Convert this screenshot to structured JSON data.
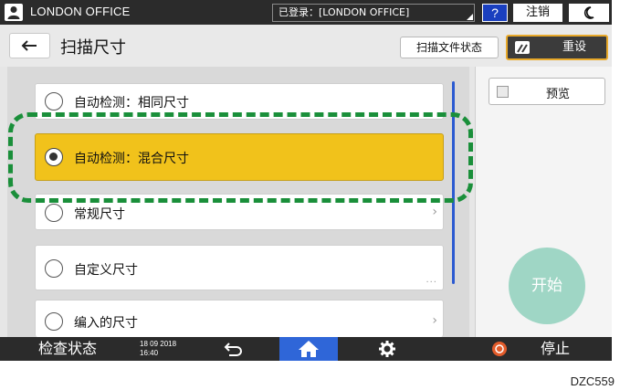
{
  "topbar": {
    "office_name": "LONDON OFFICE",
    "login_status": "已登录：[LONDON OFFICE]",
    "help_label": "?",
    "logout_label": "注销",
    "sleep_icon": "moon-icon"
  },
  "header": {
    "back_icon": "arrow-left-icon",
    "title": "扫描尺寸",
    "scan_status_label": "扫描文件状态",
    "reset_label": "重设",
    "reset_icon": "reset-icon"
  },
  "options": [
    {
      "label": "自动检测：相同尺寸",
      "selected": false,
      "chevron": false
    },
    {
      "label": "自动检测：混合尺寸",
      "selected": true,
      "chevron": false
    },
    {
      "label": "常规尺寸",
      "selected": false,
      "chevron": true
    },
    {
      "label": "自定义尺寸",
      "selected": false,
      "ellipsis": true
    },
    {
      "label": "编入的尺寸",
      "selected": false,
      "chevron": true
    }
  ],
  "right": {
    "preview_label": "预览",
    "start_label": "开始"
  },
  "bottombar": {
    "check_status_label": "检查状态",
    "date": "18 09 2018",
    "time": "16:40",
    "back_icon": "undo-arrow-icon",
    "home_icon": "home-icon",
    "settings_icon": "gear-icon",
    "stop_icon": "stop-icon",
    "stop_label": "停止"
  },
  "colors": {
    "selected_option": "#f1c21b",
    "highlight_dash": "#1a8f3a",
    "start_button": "#9fd6c5",
    "home_button": "#2f66d8"
  },
  "doc_code": "DZC559"
}
